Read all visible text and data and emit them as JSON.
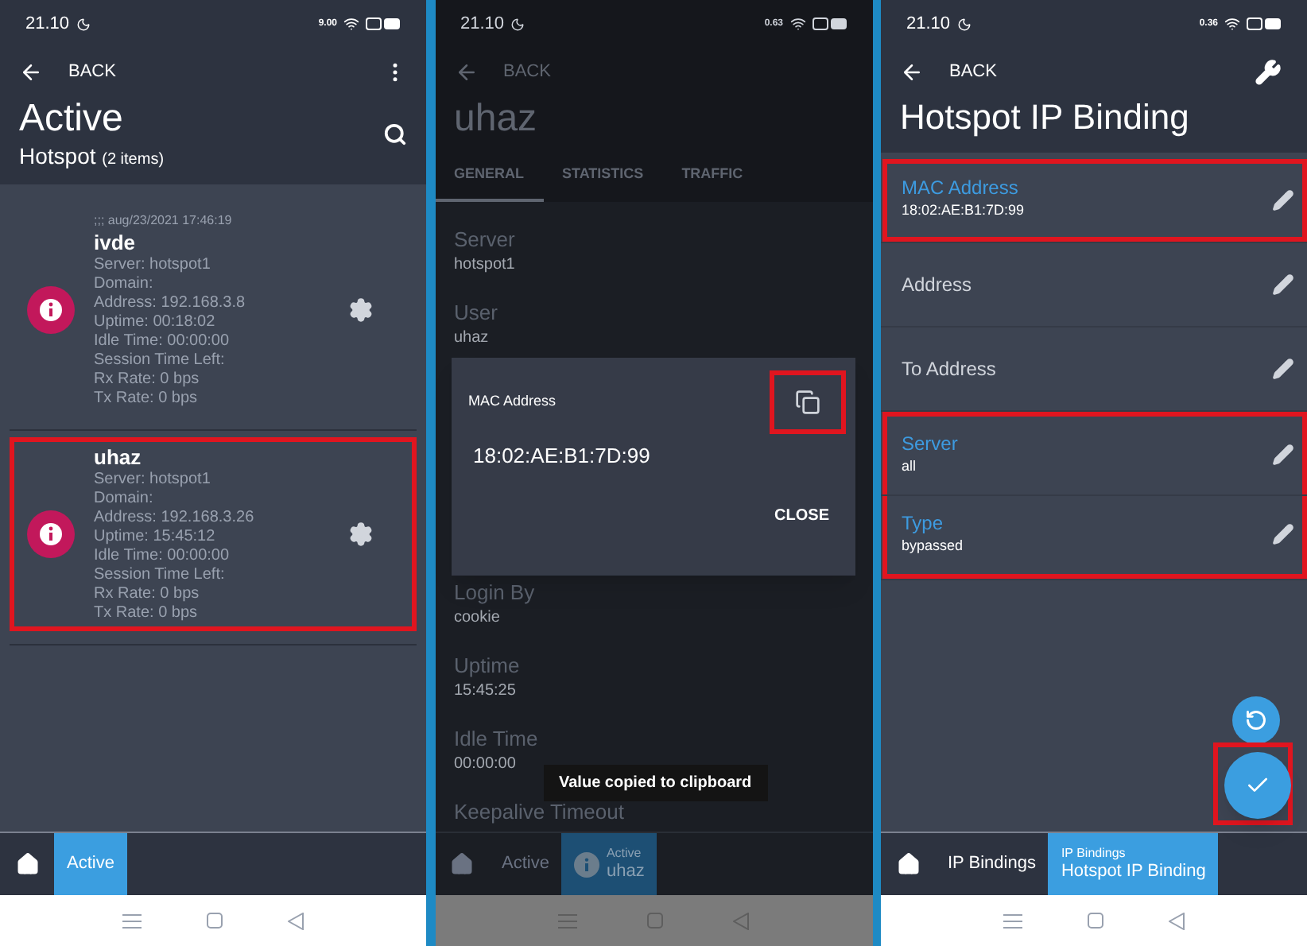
{
  "active_list_screen": {
    "status_bar": {
      "time": "21.10",
      "speed": "9.00"
    },
    "back": "BACK",
    "title": "Active",
    "subtitle": "Hotspot",
    "count": "(2 items)",
    "items": [
      {
        "timestamp": ";;; aug/23/2021 17:46:19",
        "name": "ivde",
        "details": [
          "Server: hotspot1",
          "Domain:",
          "Address: 192.168.3.8",
          "Uptime: 00:18:02",
          "Idle Time: 00:00:00",
          "Session Time Left:",
          "Rx Rate: 0 bps",
          "Tx Rate: 0 bps"
        ],
        "highlight": false
      },
      {
        "name": "uhaz",
        "details": [
          "Server: hotspot1",
          "Domain:",
          "Address: 192.168.3.26",
          "Uptime: 15:45:12",
          "Idle Time: 00:00:00",
          "Session Time Left:",
          "Rx Rate: 0 bps",
          "Tx Rate: 0 bps"
        ],
        "highlight": true
      }
    ],
    "bottom_tabs": [
      {
        "label": "Active",
        "selected": true
      }
    ]
  },
  "session_detail_screen": {
    "status_bar": {
      "time": "21.10",
      "speed": "0.63"
    },
    "back": "BACK",
    "title": "uhaz",
    "tabs": [
      {
        "label": "GENERAL",
        "selected": true
      },
      {
        "label": "STATISTICS",
        "selected": false
      },
      {
        "label": "TRAFFIC",
        "selected": false
      }
    ],
    "fields_above": [
      {
        "label": "Server",
        "value": "hotspot1"
      },
      {
        "label": "User",
        "value": "uhaz"
      }
    ],
    "fields_below": [
      {
        "label": "Login By",
        "value": "cookie"
      },
      {
        "label": "Uptime",
        "value": "15:45:25"
      },
      {
        "label": "Idle Time",
        "value": "00:00:00"
      },
      {
        "label": "Keepalive Timeout"
      }
    ],
    "dialog": {
      "label": "MAC Address",
      "value": "18:02:AE:B1:7D:99",
      "copy_highlight": true,
      "close": "CLOSE"
    },
    "toast": "Value copied to clipboard",
    "bottom_tabs": [
      {
        "label": "Active",
        "selected": false
      },
      {
        "caption": "Active",
        "label": "uhaz",
        "selected": true
      }
    ]
  },
  "ip_binding_screen": {
    "status_bar": {
      "time": "21.10",
      "speed": "0.36"
    },
    "back": "BACK",
    "title": "Hotspot IP Binding",
    "fields": [
      {
        "label": "MAC Address",
        "value": "18:02:AE:B1:7D:99",
        "highlight": true
      },
      {
        "label": "Address",
        "highlight": false
      },
      {
        "label": "To Address",
        "highlight": false
      },
      {
        "label": "Server",
        "value": "all",
        "highlight": true
      },
      {
        "label": "Type",
        "value": "bypassed",
        "highlight": true
      }
    ],
    "fab_highlight": true,
    "bottom_tabs": [
      {
        "label": "IP Bindings",
        "selected": false
      },
      {
        "caption": "IP Bindings",
        "label": "Hotspot IP Binding",
        "selected": true
      }
    ]
  }
}
